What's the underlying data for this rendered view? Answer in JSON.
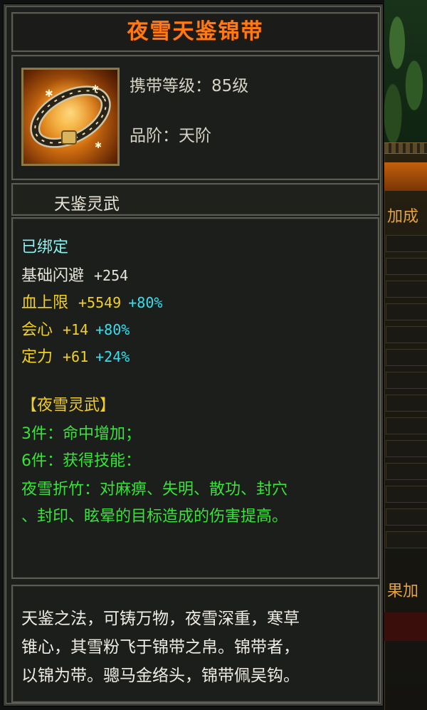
{
  "item": {
    "name": "夜雪天鉴锦带",
    "carry_level_label": "携带等级：",
    "carry_level_value": "85级",
    "grade_label": "品阶：",
    "grade_value": "天阶",
    "subtitle": "天鉴灵武"
  },
  "attributes": {
    "bound": "已绑定",
    "stats": [
      {
        "name": "基础闪避",
        "value": "+254",
        "bonus": ""
      },
      {
        "name": "血上限",
        "value": "+5549",
        "bonus": "+80%"
      },
      {
        "name": "会心",
        "value": "+14",
        "bonus": "+80%"
      },
      {
        "name": "定力",
        "value": "+61",
        "bonus": "+24%"
      }
    ],
    "set_name": "【夜雪灵武】",
    "set_bonuses": [
      "3件：命中增加；",
      "6件：获得技能：",
      "夜雪折竹：对麻痹、失明、散功、封穴",
      "、封印、眩晕的目标造成的伤害提高。"
    ]
  },
  "description": [
    "天鉴之法，可铸万物，夜雪深重，寒草",
    "锥心，其雪粉飞于锦带之帛。锦带者，",
    "以锦为带。骢马金络头，锦带佩吴钩。"
  ],
  "background": {
    "label_top": "加成",
    "label_bottom": "果加"
  },
  "colors": {
    "title": "#ff7a12",
    "stat_name": "#f2d024",
    "stat_bonus": "#32e0f0",
    "set_text": "#38e23a",
    "bound": "#8ef0f0"
  }
}
